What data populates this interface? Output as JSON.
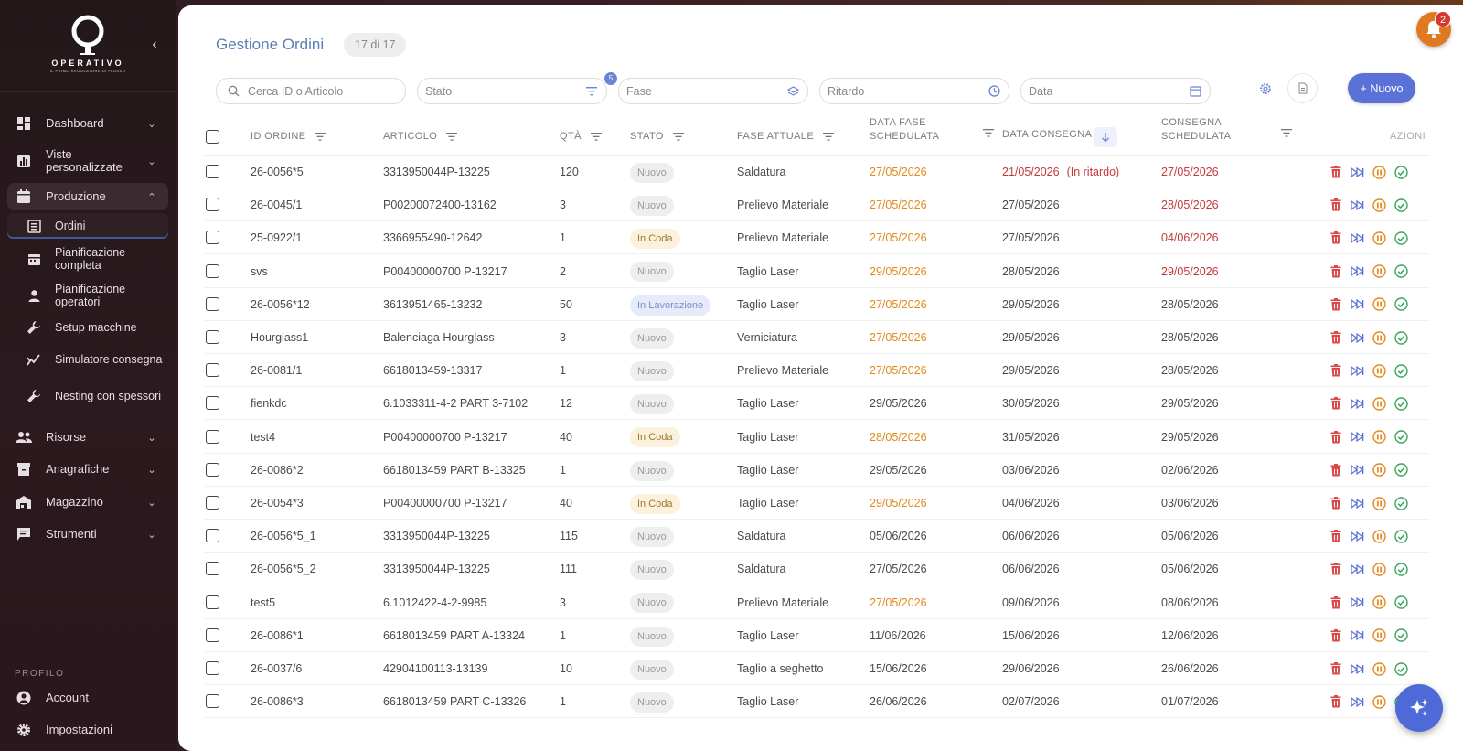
{
  "brand": {
    "name": "OPERATIVO",
    "tagline": "IL PRIMO REGOLATORE DI FLUSSO"
  },
  "sidebar": {
    "items": [
      {
        "label": "Dashboard"
      },
      {
        "label": "Viste personalizzate"
      },
      {
        "label": "Produzione"
      },
      {
        "label": "Risorse"
      },
      {
        "label": "Anagrafiche"
      },
      {
        "label": "Magazzino"
      },
      {
        "label": "Strumenti"
      }
    ],
    "sub_items": [
      {
        "label": "Ordini"
      },
      {
        "label": "Pianificazione completa"
      },
      {
        "label": "Pianificazione operatori"
      },
      {
        "label": "Setup macchine"
      },
      {
        "label": "Simulatore consegna"
      },
      {
        "label": "Nesting con spessori"
      }
    ],
    "profile_label": "PROFILO",
    "profile_items": [
      {
        "label": "Account"
      },
      {
        "label": "Impostazioni"
      }
    ]
  },
  "header": {
    "title": "Gestione Ordini",
    "count": "17 di 17",
    "notifications": "2"
  },
  "filters": {
    "search_placeholder": "Cerca ID o Articolo",
    "stato_placeholder": "Stato",
    "stato_badge": "5",
    "fase_placeholder": "Fase",
    "ritardo_placeholder": "Ritardo",
    "data_placeholder": "Data",
    "new_label": "+ Nuovo"
  },
  "table": {
    "headers": {
      "id": "ID ORDINE",
      "articolo": "ARTICOLO",
      "qta": "QTÀ",
      "stato": "STATO",
      "fase": "FASE ATTUALE",
      "data_fase_1": "DATA FASE",
      "data_fase_2": "SCHEDULATA",
      "consegna": "DATA CONSEGNA",
      "cons_sched_1": "CONSEGNA",
      "cons_sched_2": "SCHEDULATA",
      "azioni": "AZIONI"
    },
    "late_label": "(In ritardo)",
    "rows": [
      {
        "id": "26-0056*5",
        "articolo": "3313950044P-13225",
        "qta": "120",
        "stato": "Nuovo",
        "stato_type": "nuovo",
        "fase": "Saldatura",
        "data_fase": "27/05/2026",
        "data_fase_color": "orange",
        "consegna": "21/05/2026",
        "consegna_color": "red",
        "late": true,
        "cons_sched": "27/05/2026",
        "cons_sched_color": "red"
      },
      {
        "id": "26-0045/1",
        "articolo": "P00200072400-13162",
        "qta": "3",
        "stato": "Nuovo",
        "stato_type": "nuovo",
        "fase": "Prelievo Materiale",
        "data_fase": "27/05/2026",
        "data_fase_color": "orange",
        "consegna": "27/05/2026",
        "consegna_color": "",
        "late": false,
        "cons_sched": "28/05/2026",
        "cons_sched_color": "red"
      },
      {
        "id": "25-0922/1",
        "articolo": "3366955490-12642",
        "qta": "1",
        "stato": "In Coda",
        "stato_type": "coda",
        "fase": "Prelievo Materiale",
        "data_fase": "27/05/2026",
        "data_fase_color": "orange",
        "consegna": "27/05/2026",
        "consegna_color": "",
        "late": false,
        "cons_sched": "04/06/2026",
        "cons_sched_color": "red"
      },
      {
        "id": "svs",
        "articolo": "P00400000700 P-13217",
        "qta": "2",
        "stato": "Nuovo",
        "stato_type": "nuovo",
        "fase": "Taglio Laser",
        "data_fase": "29/05/2026",
        "data_fase_color": "orange",
        "consegna": "28/05/2026",
        "consegna_color": "",
        "late": false,
        "cons_sched": "29/05/2026",
        "cons_sched_color": "red"
      },
      {
        "id": "26-0056*12",
        "articolo": "3613951465-13232",
        "qta": "50",
        "stato": "In Lavorazione",
        "stato_type": "lav",
        "fase": "Taglio Laser",
        "data_fase": "27/05/2026",
        "data_fase_color": "orange",
        "consegna": "29/05/2026",
        "consegna_color": "",
        "late": false,
        "cons_sched": "28/05/2026",
        "cons_sched_color": ""
      },
      {
        "id": "Hourglass1",
        "articolo": "Balenciaga Hourglass",
        "qta": "3",
        "stato": "Nuovo",
        "stato_type": "nuovo",
        "fase": "Verniciatura",
        "data_fase": "27/05/2026",
        "data_fase_color": "orange",
        "consegna": "29/05/2026",
        "consegna_color": "",
        "late": false,
        "cons_sched": "28/05/2026",
        "cons_sched_color": ""
      },
      {
        "id": "26-0081/1",
        "articolo": "6618013459-13317",
        "qta": "1",
        "stato": "Nuovo",
        "stato_type": "nuovo",
        "fase": "Prelievo Materiale",
        "data_fase": "27/05/2026",
        "data_fase_color": "orange",
        "consegna": "29/05/2026",
        "consegna_color": "",
        "late": false,
        "cons_sched": "28/05/2026",
        "cons_sched_color": ""
      },
      {
        "id": "fienkdc",
        "articolo": "6.1033311-4-2 PART 3-7102",
        "qta": "12",
        "stato": "Nuovo",
        "stato_type": "nuovo",
        "fase": "Taglio Laser",
        "data_fase": "29/05/2026",
        "data_fase_color": "",
        "consegna": "30/05/2026",
        "consegna_color": "",
        "late": false,
        "cons_sched": "29/05/2026",
        "cons_sched_color": ""
      },
      {
        "id": "test4",
        "articolo": "P00400000700 P-13217",
        "qta": "40",
        "stato": "In Coda",
        "stato_type": "coda",
        "fase": "Taglio Laser",
        "data_fase": "28/05/2026",
        "data_fase_color": "orange",
        "consegna": "31/05/2026",
        "consegna_color": "",
        "late": false,
        "cons_sched": "29/05/2026",
        "cons_sched_color": ""
      },
      {
        "id": "26-0086*2",
        "articolo": "6618013459 PART B-13325",
        "qta": "1",
        "stato": "Nuovo",
        "stato_type": "nuovo",
        "fase": "Taglio Laser",
        "data_fase": "29/05/2026",
        "data_fase_color": "",
        "consegna": "03/06/2026",
        "consegna_color": "",
        "late": false,
        "cons_sched": "02/06/2026",
        "cons_sched_color": ""
      },
      {
        "id": "26-0054*3",
        "articolo": "P00400000700 P-13217",
        "qta": "40",
        "stato": "In Coda",
        "stato_type": "coda",
        "fase": "Taglio Laser",
        "data_fase": "29/05/2026",
        "data_fase_color": "orange",
        "consegna": "04/06/2026",
        "consegna_color": "",
        "late": false,
        "cons_sched": "03/06/2026",
        "cons_sched_color": ""
      },
      {
        "id": "26-0056*5_1",
        "articolo": "3313950044P-13225",
        "qta": "115",
        "stato": "Nuovo",
        "stato_type": "nuovo",
        "fase": "Saldatura",
        "data_fase": "05/06/2026",
        "data_fase_color": "",
        "consegna": "06/06/2026",
        "consegna_color": "",
        "late": false,
        "cons_sched": "05/06/2026",
        "cons_sched_color": ""
      },
      {
        "id": "26-0056*5_2",
        "articolo": "3313950044P-13225",
        "qta": "111",
        "stato": "Nuovo",
        "stato_type": "nuovo",
        "fase": "Saldatura",
        "data_fase": "27/05/2026",
        "data_fase_color": "",
        "consegna": "06/06/2026",
        "consegna_color": "",
        "late": false,
        "cons_sched": "05/06/2026",
        "cons_sched_color": ""
      },
      {
        "id": "test5",
        "articolo": "6.1012422-4-2-9985",
        "qta": "3",
        "stato": "Nuovo",
        "stato_type": "nuovo",
        "fase": "Prelievo Materiale",
        "data_fase": "27/05/2026",
        "data_fase_color": "orange",
        "consegna": "09/06/2026",
        "consegna_color": "",
        "late": false,
        "cons_sched": "08/06/2026",
        "cons_sched_color": ""
      },
      {
        "id": "26-0086*1",
        "articolo": "6618013459 PART A-13324",
        "qta": "1",
        "stato": "Nuovo",
        "stato_type": "nuovo",
        "fase": "Taglio Laser",
        "data_fase": "11/06/2026",
        "data_fase_color": "",
        "consegna": "15/06/2026",
        "consegna_color": "",
        "late": false,
        "cons_sched": "12/06/2026",
        "cons_sched_color": ""
      },
      {
        "id": "26-0037/6",
        "articolo": "42904100113-13139",
        "qta": "10",
        "stato": "Nuovo",
        "stato_type": "nuovo",
        "fase": "Taglio a seghetto",
        "data_fase": "15/06/2026",
        "data_fase_color": "",
        "consegna": "29/06/2026",
        "consegna_color": "",
        "late": false,
        "cons_sched": "26/06/2026",
        "cons_sched_color": ""
      },
      {
        "id": "26-0086*3",
        "articolo": "6618013459 PART C-13326",
        "qta": "1",
        "stato": "Nuovo",
        "stato_type": "nuovo",
        "fase": "Taglio Laser",
        "data_fase": "26/06/2026",
        "data_fase_color": "",
        "consegna": "02/07/2026",
        "consegna_color": "",
        "late": false,
        "cons_sched": "01/07/2026",
        "cons_sched_color": ""
      }
    ]
  },
  "colors": {
    "accent": "#5a72d8",
    "orange": "#e28a1e",
    "red": "#c33a3a",
    "title": "#5a7fb6"
  }
}
